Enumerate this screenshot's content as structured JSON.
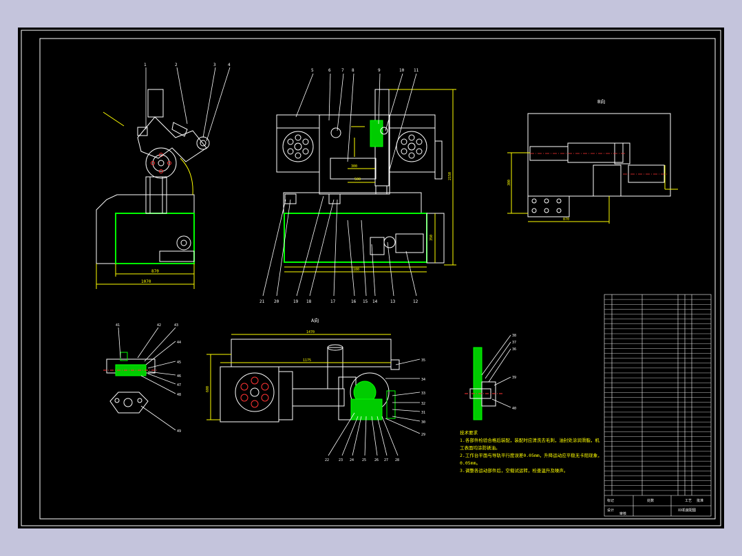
{
  "colors": {
    "background": "#c4c4dc",
    "sheet": "#000000",
    "line": "#ffffff",
    "dimension": "#ffff00",
    "housing": "#00ff00",
    "centerline": "#ff3030"
  },
  "views": {
    "view_b_label": "B向",
    "view_a_label": "A向"
  },
  "balloons": {
    "top_left": [
      "1",
      "2",
      "3",
      "4"
    ],
    "top_middle": [
      "5",
      "6",
      "7",
      "8",
      "9",
      "10",
      "11"
    ],
    "bottom_row": [
      "21",
      "20",
      "19",
      "18",
      "17",
      "16",
      "15",
      "14",
      "13",
      "12"
    ],
    "detail_left": [
      "41",
      "42",
      "43",
      "44",
      "45",
      "46",
      "47",
      "48",
      "49"
    ],
    "detail_bottom": [
      "22",
      "23",
      "24",
      "25",
      "26",
      "27",
      "28"
    ],
    "right_mid": [
      "35",
      "34",
      "33",
      "32",
      "31",
      "30",
      "29"
    ],
    "right_small": [
      "38",
      "37",
      "36",
      "39",
      "40"
    ]
  },
  "dimensions": {
    "side_width": "870",
    "side_total": "1070",
    "front_width": "1180",
    "front_height": "2150",
    "front_small": "300",
    "front_lower": "350",
    "front_mid": "500",
    "view_a_width": "1470",
    "view_a_inner": "1175",
    "view_a_height": "600",
    "view_b_width": "870",
    "view_b_height": "300"
  },
  "tech_notes": {
    "title": "技术要求",
    "lines": [
      "1.各部件检验合格后装配，装配时应清洗去毛刺，油封处涂润滑脂，机",
      "工表面均涂防锈油。",
      "2.工作台平面与导轨平行度误差0.05mm，升降运动应平稳无卡阻现象，",
      "0.05mm。",
      "3.调整各运动部件后，空载试运转，检查温升及噪声。"
    ]
  },
  "title_block": {
    "labels": [
      "标记",
      "处数",
      "设计",
      "审核",
      "工艺",
      "批准"
    ],
    "drawing_name": "XX机装配图"
  }
}
